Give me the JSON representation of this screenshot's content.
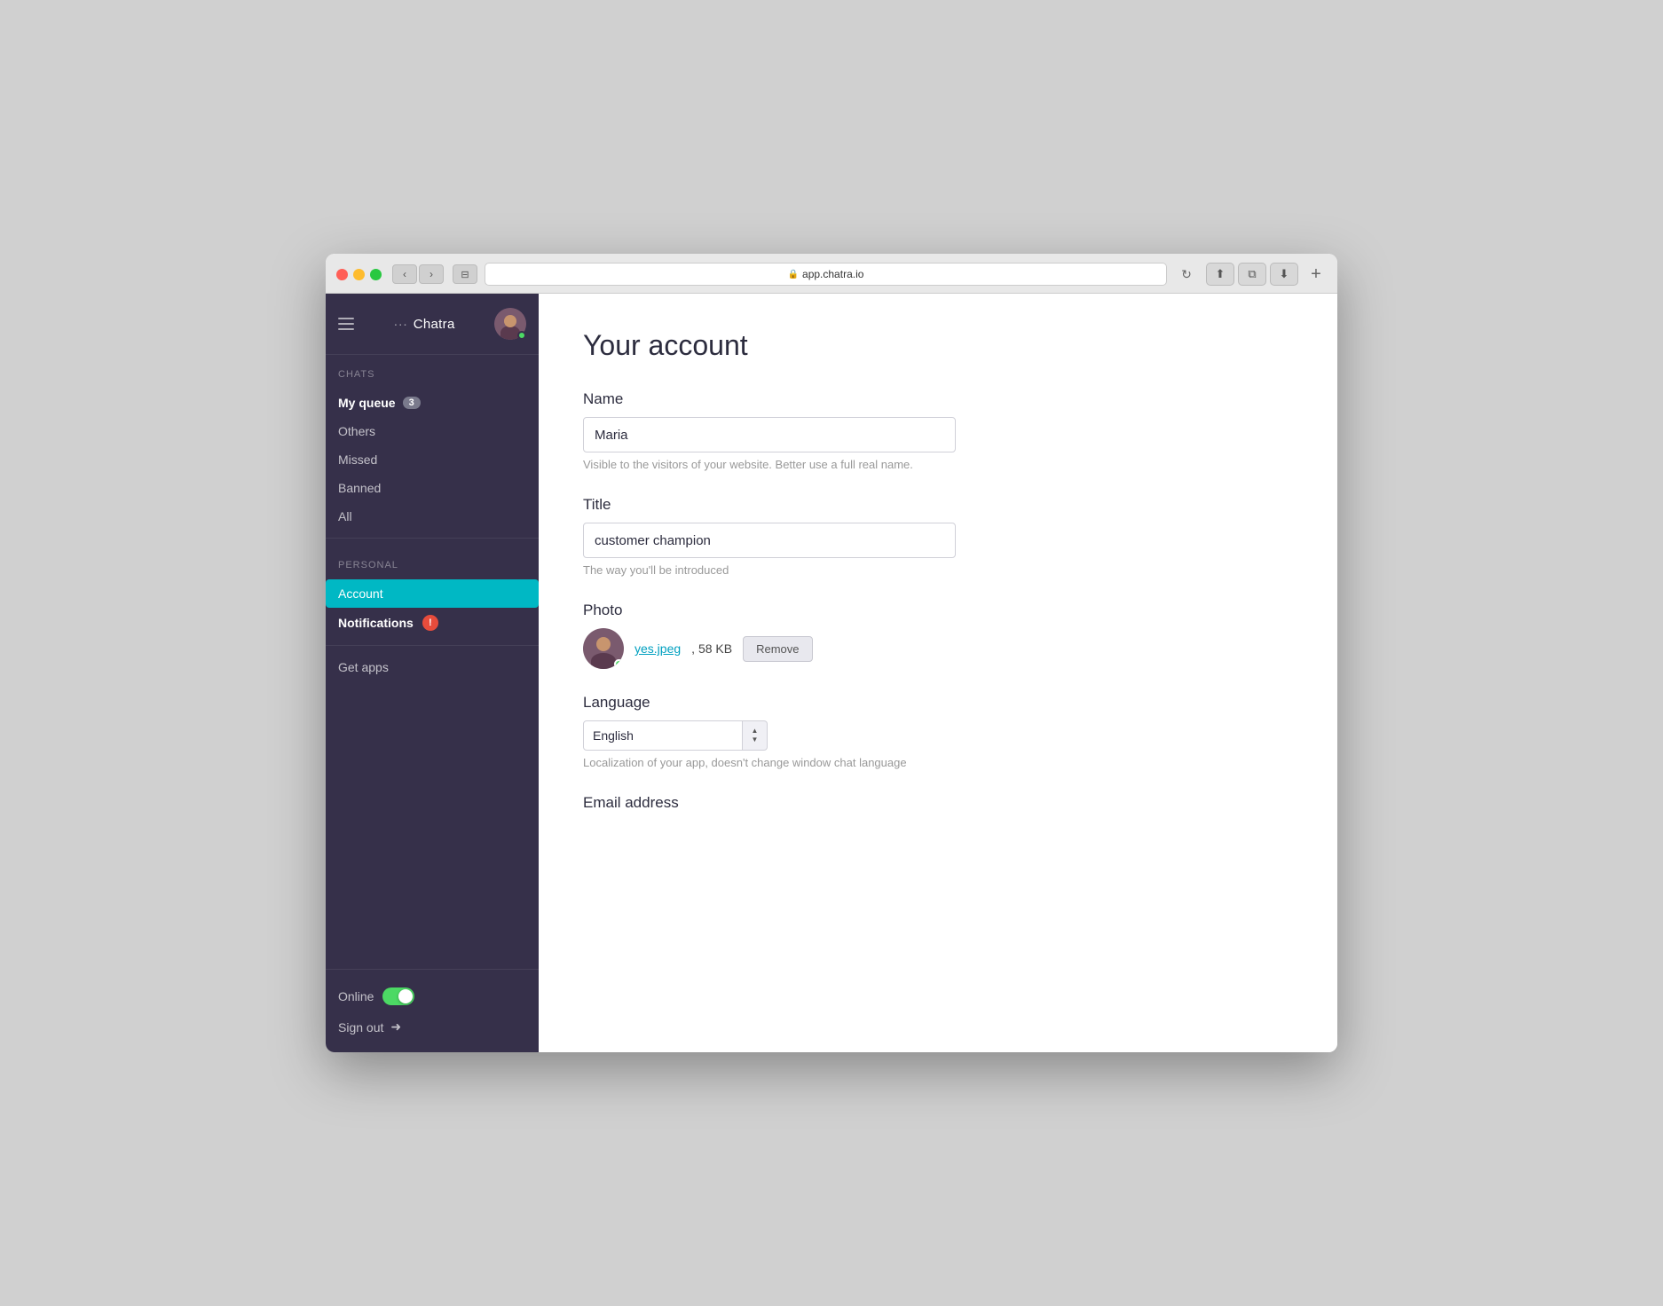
{
  "browser": {
    "url": "app.chatra.io",
    "back_label": "‹",
    "forward_label": "›",
    "sidebar_icon": "⊟",
    "refresh_label": "↻",
    "share_label": "⬆",
    "tab_label": "⧉",
    "download_label": "⬇",
    "plus_label": "+"
  },
  "sidebar": {
    "menu_title": "Chatra",
    "ellipsis": "···",
    "sections": {
      "chats_label": "CHATS",
      "personal_label": "PERSONAL"
    },
    "nav_items": [
      {
        "id": "my-queue",
        "label": "My queue",
        "badge": "3",
        "bold": true,
        "active": false
      },
      {
        "id": "others",
        "label": "Others",
        "badge": null,
        "bold": false,
        "active": false
      },
      {
        "id": "missed",
        "label": "Missed",
        "badge": null,
        "bold": false,
        "active": false
      },
      {
        "id": "banned",
        "label": "Banned",
        "badge": null,
        "bold": false,
        "active": false
      },
      {
        "id": "all",
        "label": "All",
        "badge": null,
        "bold": false,
        "active": false
      }
    ],
    "personal_items": [
      {
        "id": "account",
        "label": "Account",
        "badge": null,
        "active": true
      },
      {
        "id": "notifications",
        "label": "Notifications",
        "badge_red": "!",
        "active": false
      }
    ],
    "get_apps_label": "Get apps",
    "online_label": "Online",
    "signout_label": "Sign out",
    "signout_icon": "➜"
  },
  "main": {
    "page_title": "Your account",
    "name_label": "Name",
    "name_value": "Maria",
    "name_hint": "Visible to the visitors of your website. Better use a full real name.",
    "title_label": "Title",
    "title_value": "customer champion",
    "title_hint": "The way you'll be introduced",
    "photo_label": "Photo",
    "photo_filename": "yes.jpeg",
    "photo_size": "58 KB",
    "photo_remove_label": "Remove",
    "language_label": "Language",
    "language_value": "English",
    "language_hint": "Localization of your app, doesn't change window chat language",
    "email_label": "Email address",
    "email_hint": ""
  }
}
